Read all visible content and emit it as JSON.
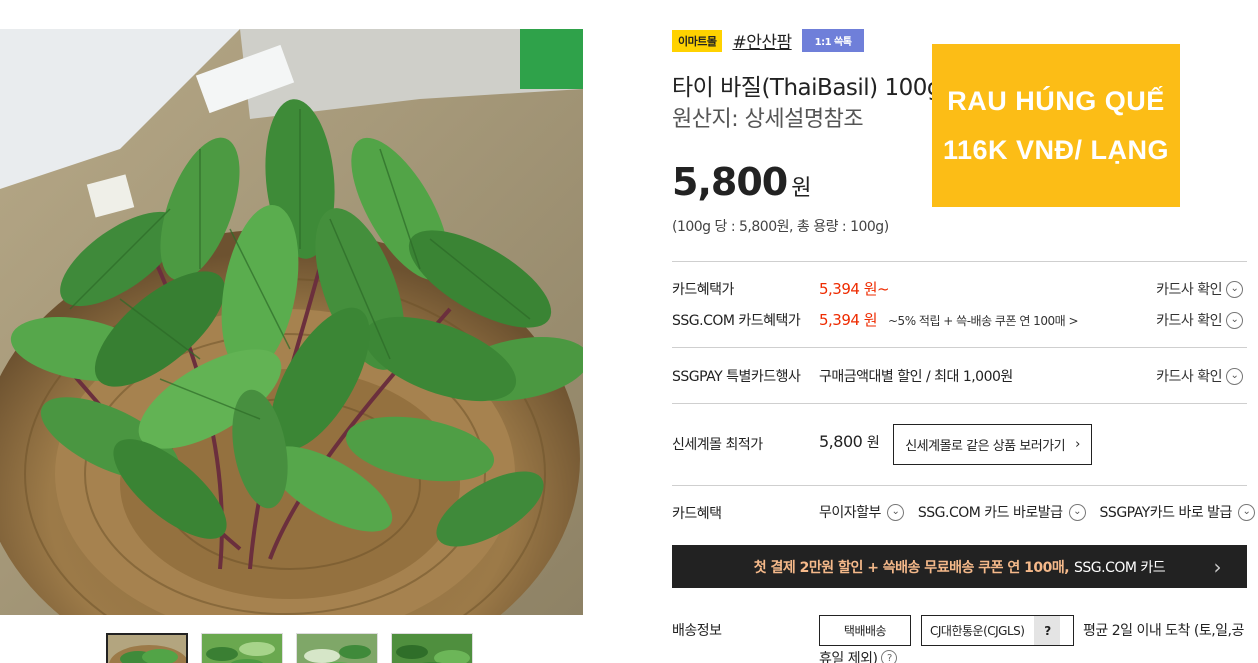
{
  "badges": {
    "mall": "이마트몰",
    "tag": "#안산팜",
    "talk": "1:1 쓱톡"
  },
  "product": {
    "title": "타이 바질(ThaiBasil) 100g",
    "origin": "원산지: 상세설명참조",
    "price": "5,800",
    "price_unit": "원",
    "unit_price": "(100g 당 : 5,800원, 총 용량 : 100g)"
  },
  "promo": {
    "line1": "RAU HÚNG QUẾ",
    "line2": "116K VNĐ/ LẠNG",
    "color": "#fcbd16"
  },
  "card_benefits": {
    "row1_label": "카드혜택가",
    "row1_value": "5,394 원~",
    "row2_label": "SSG.COM 카드혜택가",
    "row2_value": "5,394 원",
    "row2_note": "~5% 적립 + 쓱-배송 쿠폰 연 100매 >",
    "check_label": "카드사 확인"
  },
  "ssgpay": {
    "label": "SSGPAY 특별카드행사",
    "value": "구매금액대별 할인 / 최대 1,000원",
    "check_label": "카드사 확인"
  },
  "shinsegae": {
    "label": "신세계몰 최적가",
    "price": "5,800",
    "price_unit": "원",
    "button": "신세계몰로 같은 상품 보러가기"
  },
  "benefits": {
    "label": "카드혜택",
    "items": [
      "무이자할부",
      "SSG.COM 카드 바로발급",
      "SSGPAY카드 바로 발급"
    ]
  },
  "banner": {
    "highlight": "첫 결제 2만원 할인 + 쓱배송 무료배송 쿠폰 연 100매,",
    "rest": "SSG.COM 카드",
    "accent": "#f5b98a"
  },
  "shipping": {
    "label": "배송정보",
    "method": "택배배송",
    "carrier": "CJ대한통운(CJGLS)",
    "carrier_help": "?",
    "note_line1": "평균 2일 이내 도착 (토,일,공",
    "note_line2": "휴일 제외)"
  },
  "icons": {
    "chevron": "chevron-down-circle-icon",
    "arrow": "chevron-right-icon",
    "help": "question-circle-icon"
  }
}
